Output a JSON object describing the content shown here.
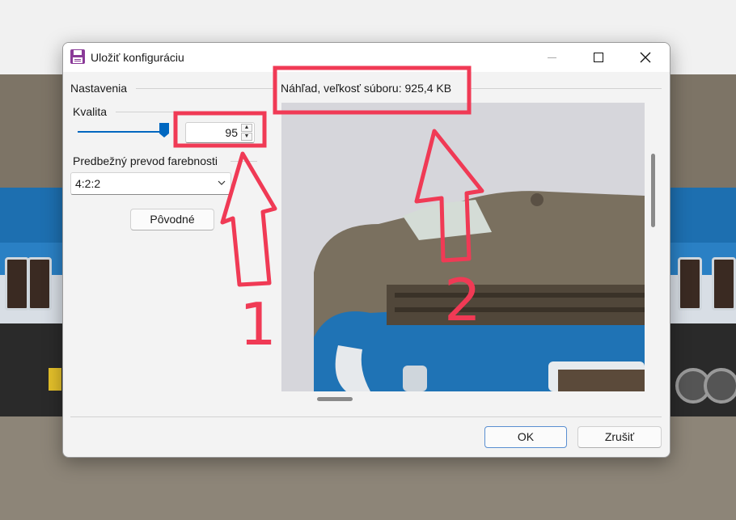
{
  "dialog": {
    "title": "Uložiť konfiguráciu",
    "icon": "save-floppy-icon",
    "window_controls": [
      "minimize-icon",
      "maximize-icon",
      "close-icon"
    ]
  },
  "settings": {
    "section_label": "Nastavenia",
    "quality": {
      "label": "Kvalita",
      "value": "95",
      "slider_level_percent": 95
    },
    "subsampling": {
      "label": "Predbežný prevod farebnosti",
      "selected": "4:2:2"
    },
    "reset_button": "Pôvodné"
  },
  "preview": {
    "label": "Náhľad, veľkosť súboru: 925,4 KB"
  },
  "buttons": {
    "ok": "OK",
    "cancel": "Zrušiť"
  },
  "annotations": {
    "highlight_color": "#f03a55",
    "marker_1": "1",
    "marker_2": "2"
  }
}
